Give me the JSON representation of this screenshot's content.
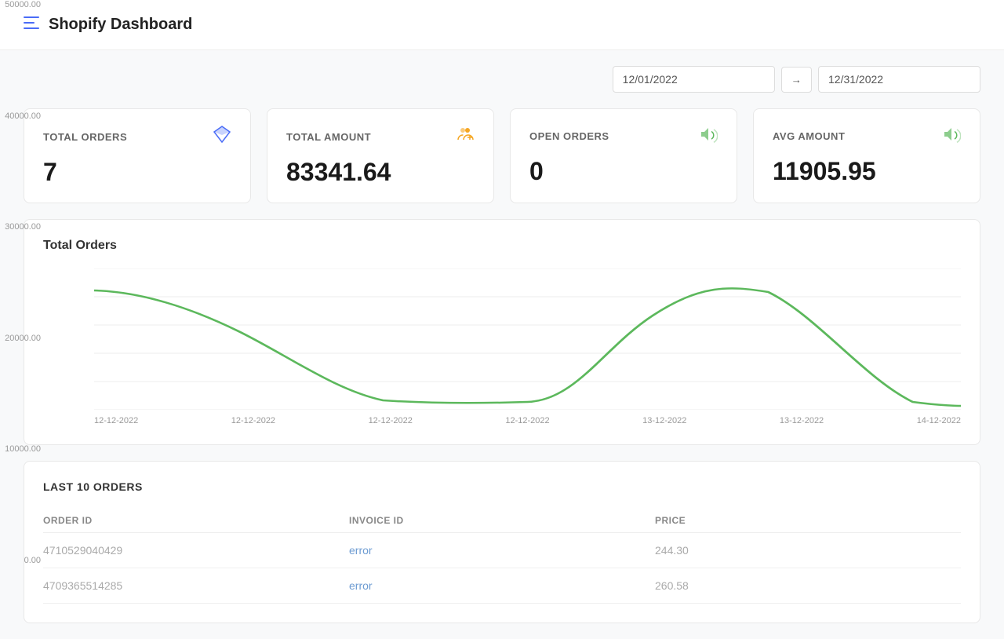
{
  "header": {
    "title": "Shopify Dashboard",
    "menu_icon": "≡"
  },
  "date_filter": {
    "start_date": "12/01/2022",
    "end_date": "12/31/2022",
    "arrow": "→"
  },
  "stats": [
    {
      "label": "TOTAL ORDERS",
      "value": "7",
      "icon": "💎",
      "icon_name": "diamond-icon"
    },
    {
      "label": "TOTAL AMOUNT",
      "value": "83341.64",
      "icon": "👥",
      "icon_name": "users-icon"
    },
    {
      "label": "OPEN ORDERS",
      "value": "0",
      "icon": "📢",
      "icon_name": "megaphone-icon"
    },
    {
      "label": "AVG AMOUNT",
      "value": "11905.95",
      "icon": "📢",
      "icon_name": "megaphone-icon-2"
    }
  ],
  "chart": {
    "title": "Total Orders",
    "y_labels": [
      "50000.00",
      "40000.00",
      "30000.00",
      "20000.00",
      "10000.00",
      "0.00"
    ],
    "x_labels": [
      "12-12-2022",
      "12-12-2022",
      "12-12-2022",
      "12-12-2022",
      "13-12-2022",
      "13-12-2022",
      "14-12-2022"
    ]
  },
  "table": {
    "title": "LAST 10 ORDERS",
    "columns": [
      "ORDER ID",
      "INVOICE ID",
      "PRICE"
    ],
    "rows": [
      {
        "order_id": "4710529040429",
        "invoice_id": "error",
        "price": "244.30"
      },
      {
        "order_id": "4709365514285",
        "invoice_id": "error",
        "price": "260.58"
      }
    ]
  }
}
